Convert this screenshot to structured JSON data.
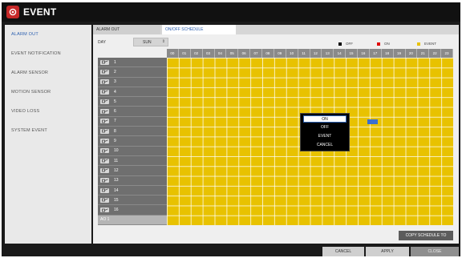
{
  "window": {
    "title": "EVENT",
    "icon": "event-icon",
    "accent": "#c62828"
  },
  "sidebar": {
    "items": [
      {
        "label": "ALARM OUT",
        "active": true
      },
      {
        "label": "EVENT NOTIFICATION",
        "active": false
      },
      {
        "label": "ALARM SENSOR",
        "active": false
      },
      {
        "label": "MOTION SENSOR",
        "active": false
      },
      {
        "label": "VIDEO LOSS",
        "active": false
      },
      {
        "label": "SYSTEM EVENT",
        "active": false
      }
    ]
  },
  "tabs": [
    {
      "label": "ALARM OUT",
      "active": false
    },
    {
      "label": "ON/OFF SCHEDULE",
      "active": true
    }
  ],
  "day": {
    "label": "DAY",
    "value": "SUN",
    "arrow": "⇕"
  },
  "legend": [
    {
      "label": "OFF",
      "color": "#000000"
    },
    {
      "label": "ON",
      "color": "#e00000"
    },
    {
      "label": "EVENT",
      "color": "#e8c200"
    }
  ],
  "schedule": {
    "hours": [
      "00",
      "01",
      "02",
      "03",
      "04",
      "05",
      "06",
      "07",
      "08",
      "09",
      "10",
      "11",
      "12",
      "13",
      "14",
      "15",
      "16",
      "17",
      "18",
      "19",
      "20",
      "21",
      "22",
      "23"
    ],
    "rows": [
      "1",
      "2",
      "3",
      "4",
      "5",
      "6",
      "7",
      "8",
      "9",
      "10",
      "11",
      "12",
      "13",
      "14",
      "15",
      "16"
    ],
    "extra_row": "AO 1",
    "cell_color": "#e8c200"
  },
  "context_menu": {
    "items": [
      "ON",
      "OFF",
      "EVENT",
      "CANCEL"
    ],
    "selected": "ON"
  },
  "copy_button": "COPY SCHEDULE TO",
  "footer": {
    "cancel": "CANCEL",
    "apply": "APPLY",
    "close": "CLOSE"
  }
}
